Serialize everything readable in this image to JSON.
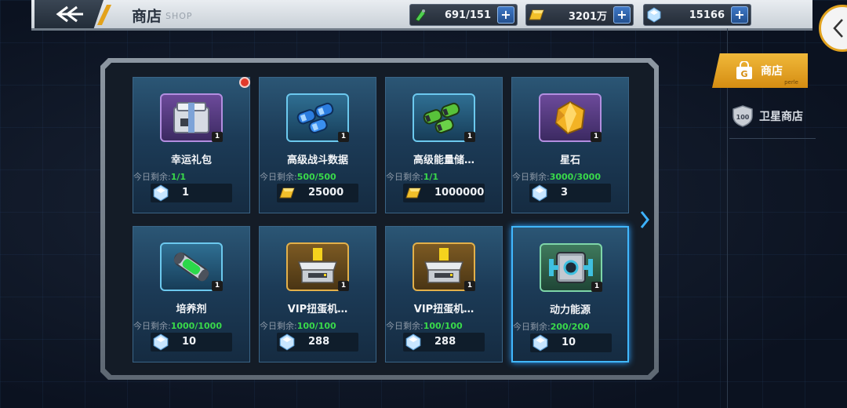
{
  "header": {
    "title": "商店",
    "subtitle": "SHOP"
  },
  "resources": [
    {
      "name": "energy",
      "icon": "energy-potion-icon",
      "value": "691/151"
    },
    {
      "name": "gold",
      "icon": "gold-bar-icon",
      "value": "3201万"
    },
    {
      "name": "diamond",
      "icon": "diamond-icon",
      "value": "15166"
    }
  ],
  "sidebar": {
    "tabs": [
      {
        "label": "商店",
        "sub": "perle",
        "active": true
      },
      {
        "label": "卫星商店",
        "icon_text": "100",
        "active": false
      }
    ]
  },
  "remaining_label": "今日剩余:",
  "items": [
    {
      "name": "幸运礼包",
      "qty": "1",
      "remaining": "1/1",
      "currency": "diamond",
      "price": "1",
      "frame": "purple",
      "icon": "gift-box-icon"
    },
    {
      "name": "高级战斗数据",
      "qty": "1",
      "remaining": "500/500",
      "currency": "gold",
      "price": "25000",
      "frame": "blue",
      "icon": "data-capsule-icon"
    },
    {
      "name": "高级能量储…",
      "qty": "1",
      "remaining": "1/1",
      "currency": "gold",
      "price": "1000000",
      "frame": "blue",
      "icon": "energy-capsule-icon"
    },
    {
      "name": "星石",
      "qty": "1",
      "remaining": "3000/3000",
      "currency": "diamond",
      "price": "3",
      "frame": "purple",
      "icon": "star-stone-icon"
    },
    {
      "name": "培养剂",
      "qty": "1",
      "remaining": "1000/1000",
      "currency": "diamond",
      "price": "10",
      "frame": "blue",
      "icon": "culture-capsule-icon"
    },
    {
      "name": "VIP扭蛋机…",
      "qty": "1",
      "remaining": "100/100",
      "currency": "diamond",
      "price": "288",
      "frame": "gold",
      "icon": "gacha-machine-icon"
    },
    {
      "name": "VIP扭蛋机…",
      "qty": "1",
      "remaining": "100/100",
      "currency": "diamond",
      "price": "288",
      "frame": "gold",
      "icon": "gacha-machine-icon"
    },
    {
      "name": "动力能源",
      "qty": "1",
      "remaining": "200/200",
      "currency": "diamond",
      "price": "10",
      "frame": "green",
      "icon": "power-cube-icon",
      "selected": true
    }
  ]
}
